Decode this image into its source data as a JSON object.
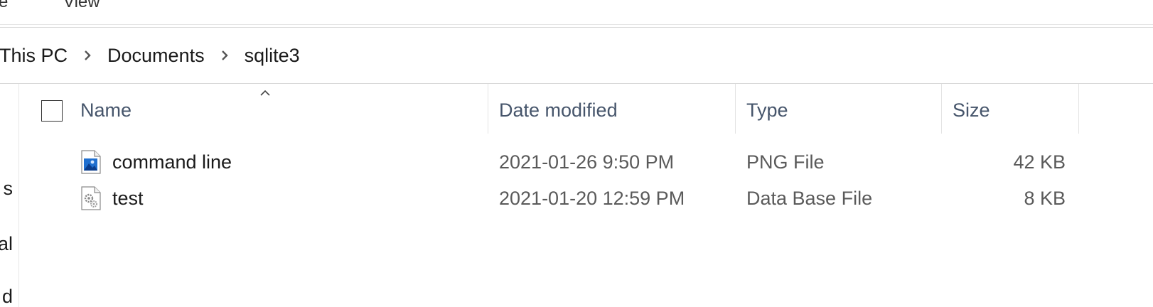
{
  "ribbon": {
    "tabs": [
      "re",
      "View"
    ]
  },
  "address_bar": {
    "crumbs": [
      "This PC",
      "Documents",
      "sqlite3"
    ]
  },
  "nav_pane": {
    "fragments": [
      "s",
      "al",
      "d"
    ]
  },
  "file_list": {
    "columns": [
      "Name",
      "Date modified",
      "Type",
      "Size"
    ],
    "sort_column": "Name",
    "rows": [
      {
        "name": "command line",
        "date": "2021-01-26 9:50 PM",
        "type": "PNG File",
        "size": "42 KB",
        "icon": "image-file-icon"
      },
      {
        "name": "test",
        "date": "2021-01-20 12:59 PM",
        "type": "Data Base File",
        "size": "8 KB",
        "icon": "settings-file-icon"
      }
    ]
  },
  "colors": {
    "header_text": "#46556b",
    "secondary_text": "#5a5a5a",
    "image_icon_blue": "#1f6fcf"
  }
}
